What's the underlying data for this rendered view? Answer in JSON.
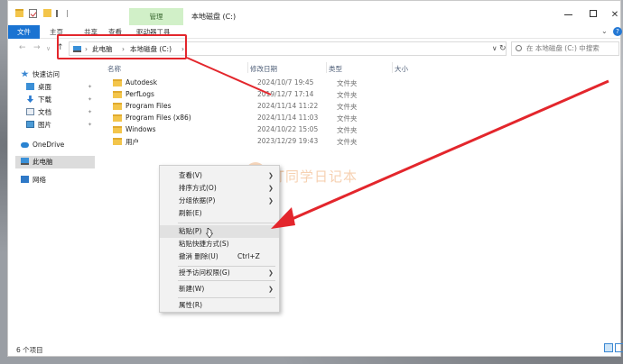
{
  "window": {
    "title": "本地磁盘 (C:)",
    "manage_tab": "管理"
  },
  "ribbon": {
    "file": "文件",
    "home": "主页",
    "share": "共享",
    "view": "查看",
    "drive_tools": "驱动器工具"
  },
  "address": {
    "crumbs": [
      "此电脑",
      "本地磁盘 (C:)"
    ],
    "search_placeholder": "在 本地磁盘 (C:) 中搜索"
  },
  "sidebar": {
    "quick_access": "快速访问",
    "desktop": "桌面",
    "downloads": "下载",
    "documents": "文档",
    "pictures": "图片",
    "onedrive": "OneDrive",
    "this_pc": "此电脑",
    "network": "网络"
  },
  "columns": {
    "name": "名称",
    "date": "修改日期",
    "type": "类型",
    "size": "大小"
  },
  "files": [
    {
      "name": "Autodesk",
      "date": "2024/10/7 19:45",
      "type": "文件夹"
    },
    {
      "name": "PerfLogs",
      "date": "2019/12/7 17:14",
      "type": "文件夹"
    },
    {
      "name": "Program Files",
      "date": "2024/11/14 11:22",
      "type": "文件夹"
    },
    {
      "name": "Program Files (x86)",
      "date": "2024/11/14 11:03",
      "type": "文件夹"
    },
    {
      "name": "Windows",
      "date": "2024/10/22 15:05",
      "type": "文件夹"
    },
    {
      "name": "用户",
      "date": "2023/12/29 19:43",
      "type": "文件夹"
    }
  ],
  "context_menu": {
    "view": "查看(V)",
    "sort": "排序方式(O)",
    "group": "分组依据(P)",
    "refresh": "刷新(E)",
    "paste": "粘贴(P)",
    "paste_shortcut": "粘贴快捷方式(S)",
    "undo": "撤消 删除(U)",
    "undo_shortcut": "Ctrl+Z",
    "grant_access": "授予访问权限(G)",
    "new": "新建(W)",
    "properties": "属性(R)"
  },
  "status": {
    "count": "6 个项目"
  },
  "watermark": "叮同学日记本",
  "colors": {
    "accent": "#1a73d2",
    "highlight": "#e3262c",
    "manage_bg": "#d1f0c8"
  }
}
